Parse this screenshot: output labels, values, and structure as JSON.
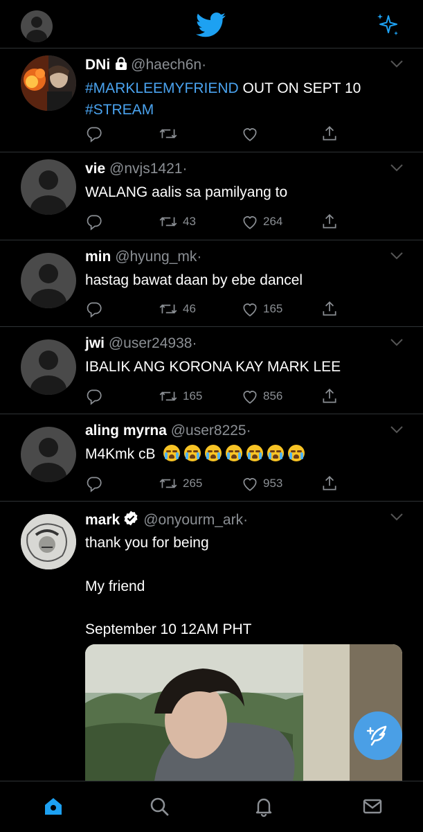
{
  "colors": {
    "accent": "#1da1f2",
    "link": "#4aa3ef",
    "muted": "#8b8f94",
    "background": "#000000",
    "divider": "#2f3336"
  },
  "topbar": {
    "profile_icon": "user-avatar-icon",
    "logo_icon": "twitter-bird-icon",
    "right_icon": "sparkle-icon"
  },
  "tweets": [
    {
      "name": "DNi",
      "protected": true,
      "handle": "@haech6n",
      "separator": "·",
      "text_parts": [
        "#MARKLEEMYFRIEND",
        " OUT ON SEPT 10",
        "#STREAM"
      ],
      "retweets": "",
      "likes": ""
    },
    {
      "name": "vie",
      "handle": "@nvjs1421",
      "separator": "·",
      "text": "WALANG aalis sa pamilyang to",
      "retweets": "43",
      "likes": "264"
    },
    {
      "name": "min",
      "handle": "@hyung_mk",
      "separator": "·",
      "text": "hastag bawat daan by ebe dancel",
      "retweets": "46",
      "likes": "165"
    },
    {
      "name": "jwi",
      "handle": "@user24938",
      "separator": "·",
      "text": "IBALIK ANG KORONA KAY MARK LEE",
      "retweets": "165",
      "likes": "856"
    },
    {
      "name": "aling myrna",
      "handle": "@user8225",
      "separator": "·",
      "text": "M4Kmk cB",
      "emoji": "loudly-crying-face",
      "emoji_count": 7,
      "retweets": "265",
      "likes": "953"
    },
    {
      "name": "mark",
      "verified": true,
      "handle": "@onyourm_ark",
      "separator": "·",
      "lines": [
        "thank you for being",
        "My friend",
        "September 10 12AM PHT"
      ]
    }
  ],
  "fab": {
    "icon": "compose-tweet-icon"
  },
  "bottom_nav": [
    "home-icon",
    "search-icon",
    "notifications-icon",
    "messages-icon"
  ]
}
